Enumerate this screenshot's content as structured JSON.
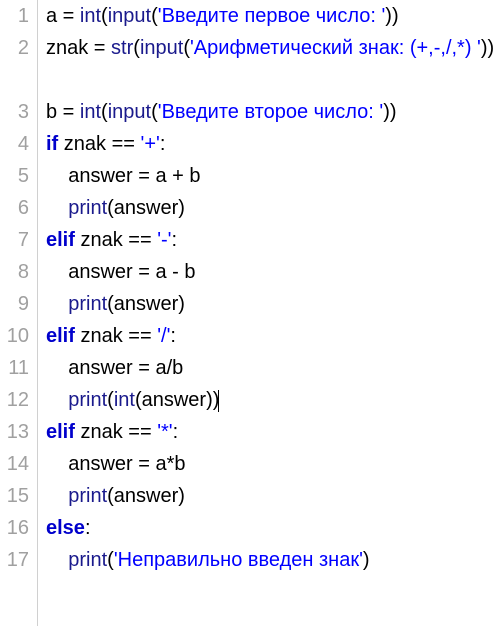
{
  "code": {
    "lines": [
      {
        "num": "1",
        "tokens": [
          {
            "t": "a = ",
            "c": "plain"
          },
          {
            "t": "int",
            "c": "builtin"
          },
          {
            "t": "(",
            "c": "plain"
          },
          {
            "t": "input",
            "c": "builtin"
          },
          {
            "t": "(",
            "c": "plain"
          },
          {
            "t": "'Введите первое число: '",
            "c": "str"
          },
          {
            "t": "))",
            "c": "plain"
          }
        ]
      },
      {
        "num": "2",
        "wrap": true,
        "tokens": [
          {
            "t": "znak = ",
            "c": "plain"
          },
          {
            "t": "str",
            "c": "builtin"
          },
          {
            "t": "(",
            "c": "plain"
          },
          {
            "t": "input",
            "c": "builtin"
          },
          {
            "t": "(",
            "c": "plain"
          },
          {
            "t": "'Арифметический знак: (+,-,/,*) '",
            "c": "str"
          },
          {
            "t": "))",
            "c": "plain"
          }
        ]
      },
      {
        "num": "3",
        "tokens": [
          {
            "t": "b = ",
            "c": "plain"
          },
          {
            "t": "int",
            "c": "builtin"
          },
          {
            "t": "(",
            "c": "plain"
          },
          {
            "t": "input",
            "c": "builtin"
          },
          {
            "t": "(",
            "c": "plain"
          },
          {
            "t": "'Введите второе число: '",
            "c": "str"
          },
          {
            "t": "))",
            "c": "plain"
          }
        ]
      },
      {
        "num": "4",
        "tokens": [
          {
            "t": "if",
            "c": "kw"
          },
          {
            "t": " znak == ",
            "c": "plain"
          },
          {
            "t": "'+'",
            "c": "str"
          },
          {
            "t": ":",
            "c": "plain"
          }
        ]
      },
      {
        "num": "5",
        "tokens": [
          {
            "t": "    answer = a + b",
            "c": "plain"
          }
        ]
      },
      {
        "num": "6",
        "tokens": [
          {
            "t": "    ",
            "c": "plain"
          },
          {
            "t": "print",
            "c": "builtin"
          },
          {
            "t": "(answer)",
            "c": "plain"
          }
        ]
      },
      {
        "num": "7",
        "tokens": [
          {
            "t": "elif",
            "c": "kw"
          },
          {
            "t": " znak == ",
            "c": "plain"
          },
          {
            "t": "'-'",
            "c": "str"
          },
          {
            "t": ":",
            "c": "plain"
          }
        ]
      },
      {
        "num": "8",
        "tokens": [
          {
            "t": "    answer = a - b",
            "c": "plain"
          }
        ]
      },
      {
        "num": "9",
        "tokens": [
          {
            "t": "    ",
            "c": "plain"
          },
          {
            "t": "print",
            "c": "builtin"
          },
          {
            "t": "(answer)",
            "c": "plain"
          }
        ]
      },
      {
        "num": "10",
        "tokens": [
          {
            "t": "elif",
            "c": "kw"
          },
          {
            "t": " znak == ",
            "c": "plain"
          },
          {
            "t": "'/'",
            "c": "str"
          },
          {
            "t": ":",
            "c": "plain"
          }
        ]
      },
      {
        "num": "11",
        "tokens": [
          {
            "t": "    answer = a/b",
            "c": "plain"
          }
        ]
      },
      {
        "num": "12",
        "cursor": true,
        "tokens": [
          {
            "t": "    ",
            "c": "plain"
          },
          {
            "t": "print",
            "c": "builtin"
          },
          {
            "t": "(",
            "c": "plain"
          },
          {
            "t": "int",
            "c": "builtin"
          },
          {
            "t": "(answer))",
            "c": "plain"
          }
        ]
      },
      {
        "num": "13",
        "tokens": [
          {
            "t": "elif",
            "c": "kw"
          },
          {
            "t": " znak == ",
            "c": "plain"
          },
          {
            "t": "'*'",
            "c": "str"
          },
          {
            "t": ":",
            "c": "plain"
          }
        ]
      },
      {
        "num": "14",
        "tokens": [
          {
            "t": "    answer = a*b",
            "c": "plain"
          }
        ]
      },
      {
        "num": "15",
        "tokens": [
          {
            "t": "    ",
            "c": "plain"
          },
          {
            "t": "print",
            "c": "builtin"
          },
          {
            "t": "(answer)",
            "c": "plain"
          }
        ]
      },
      {
        "num": "16",
        "tokens": [
          {
            "t": "else",
            "c": "kw"
          },
          {
            "t": ":",
            "c": "plain"
          }
        ]
      },
      {
        "num": "17",
        "tokens": [
          {
            "t": "    ",
            "c": "plain"
          },
          {
            "t": "print",
            "c": "builtin"
          },
          {
            "t": "(",
            "c": "plain"
          },
          {
            "t": "'Неправильно введен знак'",
            "c": "str"
          },
          {
            "t": ")",
            "c": "plain"
          }
        ]
      }
    ]
  }
}
